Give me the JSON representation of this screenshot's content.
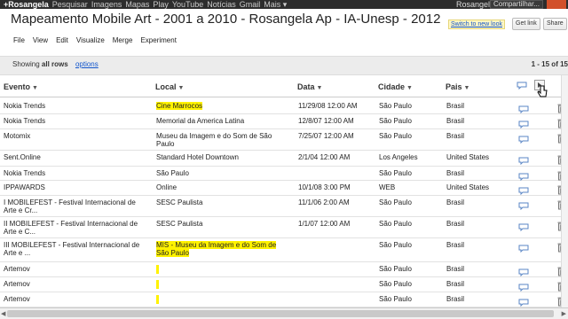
{
  "topnav": {
    "items": [
      "+Rosangela",
      "Pesquisar",
      "Imagens",
      "Mapas",
      "Play",
      "YouTube",
      "Notícias",
      "Gmail",
      "Mais ▾"
    ],
    "user": "Rosangela Ap",
    "share": "Compartilhar..."
  },
  "doc": {
    "title": "Mapeamento Mobile Art - 2001 a 2010 - Rosangela Ap - IA-Unesp - 2012",
    "new_look": "Switch to new look",
    "get_link": "Get link",
    "share": "Share"
  },
  "menu": [
    "File",
    "View",
    "Edit",
    "Visualize",
    "Merge",
    "Experiment"
  ],
  "filter": {
    "showing_prefix": "Showing",
    "showing_bold": "all rows",
    "options": "options",
    "range": "1 - 15 of",
    "total": "15"
  },
  "columns": {
    "evento": "Evento",
    "local": "Local",
    "data": "Data",
    "cidade": "Cidade",
    "pais": "Pais"
  },
  "rows": [
    {
      "evento": "Nokia Trends",
      "local": "Cine Marrocos",
      "data": "11/29/08 12:00 AM",
      "cidade": "São Paulo",
      "pais": "Brasil",
      "hl": true
    },
    {
      "evento": "Nokia Trends",
      "local": "Memorial da America Latina",
      "data": "12/8/07 12:00 AM",
      "cidade": "São Paulo",
      "pais": "Brasil",
      "hl": false
    },
    {
      "evento": "Motomix",
      "local": "Museu da Imagem e do Som de São Paulo",
      "data": "7/25/07 12:00 AM",
      "cidade": "São Paulo",
      "pais": "Brasil",
      "hl": false
    },
    {
      "evento": "Sent.Online",
      "local": "Standard Hotel Downtown",
      "data": "2/1/04 12:00 AM",
      "cidade": "Los Angeles",
      "pais": "United States",
      "hl": false
    },
    {
      "evento": "Nokia Trends",
      "local": "São Paulo",
      "data": "",
      "cidade": "São Paulo",
      "pais": "Brasil",
      "hl": false
    },
    {
      "evento": "IPPAWARDS",
      "local": "Online",
      "data": "10/1/08 3:00 PM",
      "cidade": "WEB",
      "pais": "United States",
      "hl": false
    },
    {
      "evento": "I MOBILEFEST - Festival Internacional de Arte e Cr...",
      "local": "SESC Paulista",
      "data": "11/1/06 2:00 AM",
      "cidade": "São Paulo",
      "pais": "Brasil",
      "hl": false
    },
    {
      "evento": "II MOBILEFEST - Festival Internacional de Arte e C...",
      "local": "SESC Paulista",
      "data": "1/1/07 12:00 AM",
      "cidade": "São Paulo",
      "pais": "Brasil",
      "hl": false
    },
    {
      "evento": "III MOBILEFEST - Festival Internacional de Arte e ...",
      "local": "MIS - Museu da Imagem e do Som de São Paulo",
      "data": "",
      "cidade": "São Paulo",
      "pais": "Brasil",
      "hl": true
    },
    {
      "evento": "Artemov",
      "local": "",
      "data": "",
      "cidade": "São Paulo",
      "pais": "Brasil",
      "hl": "bar"
    },
    {
      "evento": "Artemov",
      "local": "",
      "data": "",
      "cidade": "São Paulo",
      "pais": "Brasil",
      "hl": "bar"
    },
    {
      "evento": "Artemov",
      "local": "",
      "data": "",
      "cidade": "São Paulo",
      "pais": "Brasil",
      "hl": "bar"
    },
    {
      "evento": "Artemov",
      "local": "",
      "data": "",
      "cidade": "São Paulo",
      "pais": "Brasil",
      "hl": "bar"
    }
  ],
  "colors": {
    "highlight": "#fff200",
    "link": "#1155cc",
    "topbar": "#2d2d2d"
  },
  "icons": {
    "comment": "comment-icon",
    "delete": "trash-icon",
    "sort": "sort-arrow-icon"
  }
}
